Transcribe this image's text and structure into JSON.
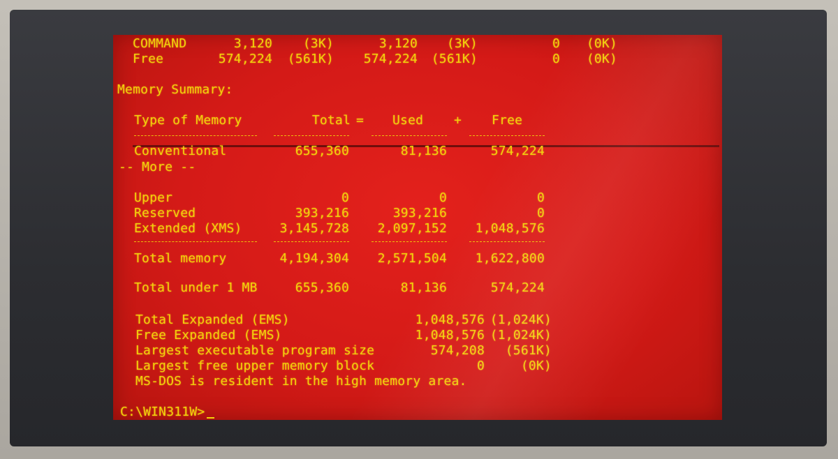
{
  "top_rows": [
    {
      "name": "COMMAND",
      "total": "3,120",
      "total_k": "(3K)",
      "conv": "3,120",
      "conv_k": "(3K)",
      "upper": "0",
      "upper_k": "(0K)"
    },
    {
      "name": "Free",
      "total": "574,224",
      "total_k": "(561K)",
      "conv": "574,224",
      "conv_k": "(561K)",
      "upper": "0",
      "upper_k": "(0K)"
    }
  ],
  "summary": {
    "heading": "Memory Summary:",
    "columns": {
      "type": "Type of Memory",
      "total": "Total",
      "eq": "=",
      "used": "Used",
      "plus": "+",
      "free": "Free"
    },
    "conventional": {
      "label": "Conventional",
      "total": "655,360",
      "used": "81,136",
      "free": "574,224"
    },
    "more_prompt": "-- More --",
    "rows": [
      {
        "label": "Upper",
        "total": "0",
        "used": "0",
        "free": "0"
      },
      {
        "label": "Reserved",
        "total": "393,216",
        "used": "393,216",
        "free": "0"
      },
      {
        "label": "Extended (XMS)",
        "total": "3,145,728",
        "used": "2,097,152",
        "free": "1,048,576"
      }
    ],
    "total_memory": {
      "label": "Total memory",
      "total": "4,194,304",
      "used": "2,571,504",
      "free": "1,622,800"
    },
    "total_under_1mb": {
      "label": "Total under 1 MB",
      "total": "655,360",
      "used": "81,136",
      "free": "574,224"
    }
  },
  "ems": [
    {
      "label": "Total Expanded (EMS)",
      "value": "1,048,576",
      "value_k": "(1,024K)"
    },
    {
      "label": "Free Expanded (EMS)",
      "value": "1,048,576",
      "value_k": "(1,024K)"
    },
    {
      "label": "Largest executable program size",
      "value": "574,208",
      "value_k": "(561K)"
    },
    {
      "label": "Largest free upper memory block",
      "value": "0",
      "value_k": "(0K)"
    }
  ],
  "hma_message": "MS-DOS is resident in the high memory area.",
  "prompt": "C:\\WIN311W>",
  "colors": {
    "screen": "#d41a17",
    "text": "#f2d20a",
    "bezel": "#2c2d31"
  }
}
